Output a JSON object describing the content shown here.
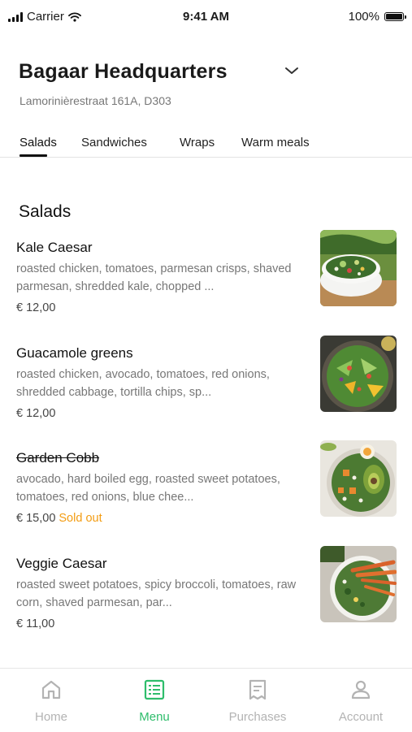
{
  "status_bar": {
    "carrier": "Carrier",
    "time": "9:41 AM",
    "battery": "100%"
  },
  "header": {
    "title": "Bagaar Headquarters",
    "address": "Lamorinièrestraat 161A, D303"
  },
  "tabs": [
    {
      "label": "Salads",
      "active": true
    },
    {
      "label": "Sandwiches",
      "active": false
    },
    {
      "label": "Wraps",
      "active": false
    },
    {
      "label": "Warm meals",
      "active": false
    }
  ],
  "section": {
    "title": "Salads"
  },
  "items": [
    {
      "name": "Kale Caesar",
      "desc_lines": [
        "roasted chicken, tomatoes, parmesan crisps, shaved",
        "parmesan, shredded kale, chopped ..."
      ],
      "price": "€ 12,00",
      "sold_out": false,
      "status": ""
    },
    {
      "name": "Guacamole greens",
      "desc_lines": [
        "roasted chicken, avocado, tomatoes, red onions,",
        "shredded cabbage, tortilla chips, sp..."
      ],
      "price": "€ 12,00",
      "sold_out": false,
      "status": ""
    },
    {
      "name": "Garden Cobb",
      "desc_lines": [
        "avocado, hard boiled egg, roasted sweet potatoes,",
        "tomatoes, red onions, blue chee..."
      ],
      "price": "€ 15,00",
      "sold_out": true,
      "status": "Sold out"
    },
    {
      "name": "Veggie Caesar",
      "desc_lines": [
        "roasted sweet potatoes, spicy broccoli, tomatoes, raw",
        "corn, shaved parmesan, par..."
      ],
      "price": "€ 11,00",
      "sold_out": false,
      "status": ""
    }
  ],
  "bottom_nav": [
    {
      "label": "Home",
      "icon": "home-icon",
      "active": false
    },
    {
      "label": "Menu",
      "icon": "menu-icon",
      "active": true
    },
    {
      "label": "Purchases",
      "icon": "receipt-icon",
      "active": false
    },
    {
      "label": "Account",
      "icon": "account-icon",
      "active": false
    }
  ],
  "colors": {
    "accent": "#2ebd6b",
    "sold_out": "#f39c12",
    "muted": "#777777"
  }
}
